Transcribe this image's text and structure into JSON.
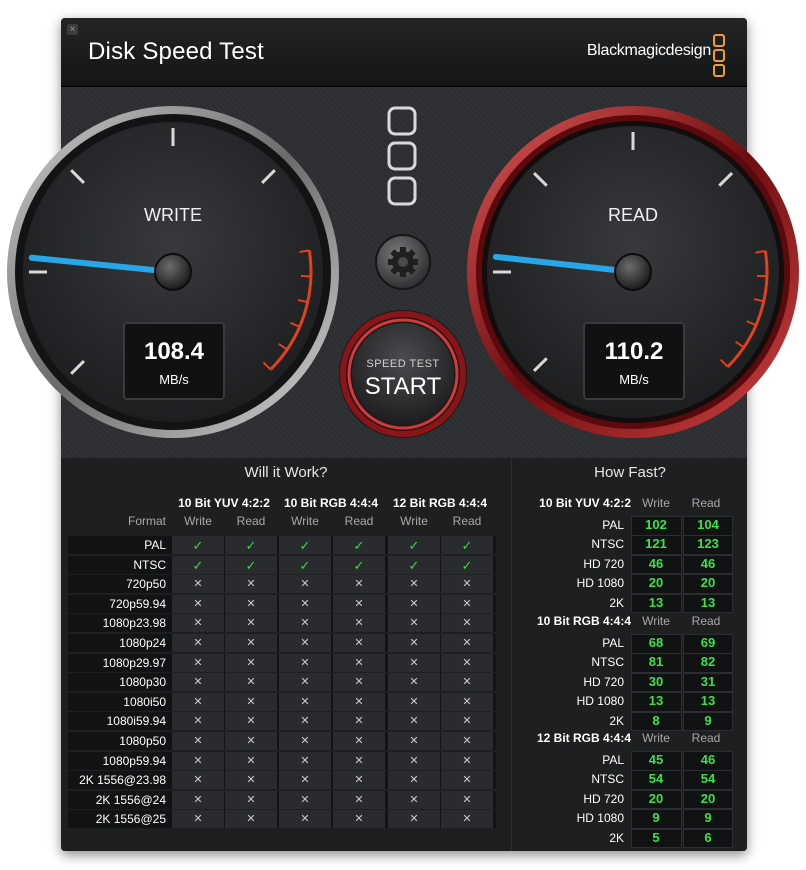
{
  "window": {
    "title": "Disk Speed Test",
    "brand": "Blackmagicdesign",
    "close_label": "×"
  },
  "gauges": {
    "write": {
      "label": "WRITE",
      "value": "108.4",
      "unit": "MB/s",
      "needle_fraction": 0.188
    },
    "read": {
      "label": "READ",
      "value": "110.2",
      "unit": "MB/s",
      "needle_fraction": 0.19
    }
  },
  "controls": {
    "start_small": "SPEED TEST",
    "start_big": "START",
    "settings_icon": "gear-icon",
    "drive_icon": "drive-slots-icon"
  },
  "will_it_work": {
    "title": "Will it Work?",
    "format_label": "Format",
    "groups": [
      "10 Bit YUV 4:2:2",
      "10 Bit RGB 4:4:4",
      "12 Bit RGB 4:4:4"
    ],
    "sub_labels": [
      "Write",
      "Read"
    ],
    "rows": [
      {
        "format": "PAL",
        "marks": [
          true,
          true,
          true,
          true,
          true,
          true
        ]
      },
      {
        "format": "NTSC",
        "marks": [
          true,
          true,
          true,
          true,
          true,
          true
        ]
      },
      {
        "format": "720p50",
        "marks": [
          false,
          false,
          false,
          false,
          false,
          false
        ]
      },
      {
        "format": "720p59.94",
        "marks": [
          false,
          false,
          false,
          false,
          false,
          false
        ]
      },
      {
        "format": "1080p23.98",
        "marks": [
          false,
          false,
          false,
          false,
          false,
          false
        ]
      },
      {
        "format": "1080p24",
        "marks": [
          false,
          false,
          false,
          false,
          false,
          false
        ]
      },
      {
        "format": "1080p29.97",
        "marks": [
          false,
          false,
          false,
          false,
          false,
          false
        ]
      },
      {
        "format": "1080p30",
        "marks": [
          false,
          false,
          false,
          false,
          false,
          false
        ]
      },
      {
        "format": "1080i50",
        "marks": [
          false,
          false,
          false,
          false,
          false,
          false
        ]
      },
      {
        "format": "1080i59.94",
        "marks": [
          false,
          false,
          false,
          false,
          false,
          false
        ]
      },
      {
        "format": "1080p50",
        "marks": [
          false,
          false,
          false,
          false,
          false,
          false
        ]
      },
      {
        "format": "1080p59.94",
        "marks": [
          false,
          false,
          false,
          false,
          false,
          false
        ]
      },
      {
        "format": "2K 1556@23.98",
        "marks": [
          false,
          false,
          false,
          false,
          false,
          false
        ]
      },
      {
        "format": "2K 1556@24",
        "marks": [
          false,
          false,
          false,
          false,
          false,
          false
        ]
      },
      {
        "format": "2K 1556@25",
        "marks": [
          false,
          false,
          false,
          false,
          false,
          false
        ]
      }
    ],
    "check_glyph": "✓",
    "cross_glyph": "✕"
  },
  "how_fast": {
    "title": "How Fast?",
    "sections": [
      {
        "name": "10 Bit YUV 4:2:2",
        "write_label": "Write",
        "read_label": "Read",
        "rows": [
          [
            "PAL",
            "102",
            "104"
          ],
          [
            "NTSC",
            "121",
            "123"
          ],
          [
            "HD 720",
            "46",
            "46"
          ],
          [
            "HD 1080",
            "20",
            "20"
          ],
          [
            "2K",
            "13",
            "13"
          ]
        ]
      },
      {
        "name": "10 Bit RGB 4:4:4",
        "write_label": "Write",
        "read_label": "Read",
        "rows": [
          [
            "PAL",
            "68",
            "69"
          ],
          [
            "NTSC",
            "81",
            "82"
          ],
          [
            "HD 720",
            "30",
            "31"
          ],
          [
            "HD 1080",
            "13",
            "13"
          ],
          [
            "2K",
            "8",
            "9"
          ]
        ]
      },
      {
        "name": "12 Bit RGB 4:4:4",
        "write_label": "Write",
        "read_label": "Read",
        "rows": [
          [
            "PAL",
            "45",
            "46"
          ],
          [
            "NTSC",
            "54",
            "54"
          ],
          [
            "HD 720",
            "20",
            "20"
          ],
          [
            "HD 1080",
            "9",
            "9"
          ],
          [
            "2K",
            "5",
            "6"
          ]
        ]
      }
    ]
  },
  "colors": {
    "accent_orange": "#f09a3c",
    "needle_blue": "#27a6e8",
    "read_ring_red": "#a3181c",
    "value_green": "#3de04b",
    "check_green": "#3ad846"
  }
}
